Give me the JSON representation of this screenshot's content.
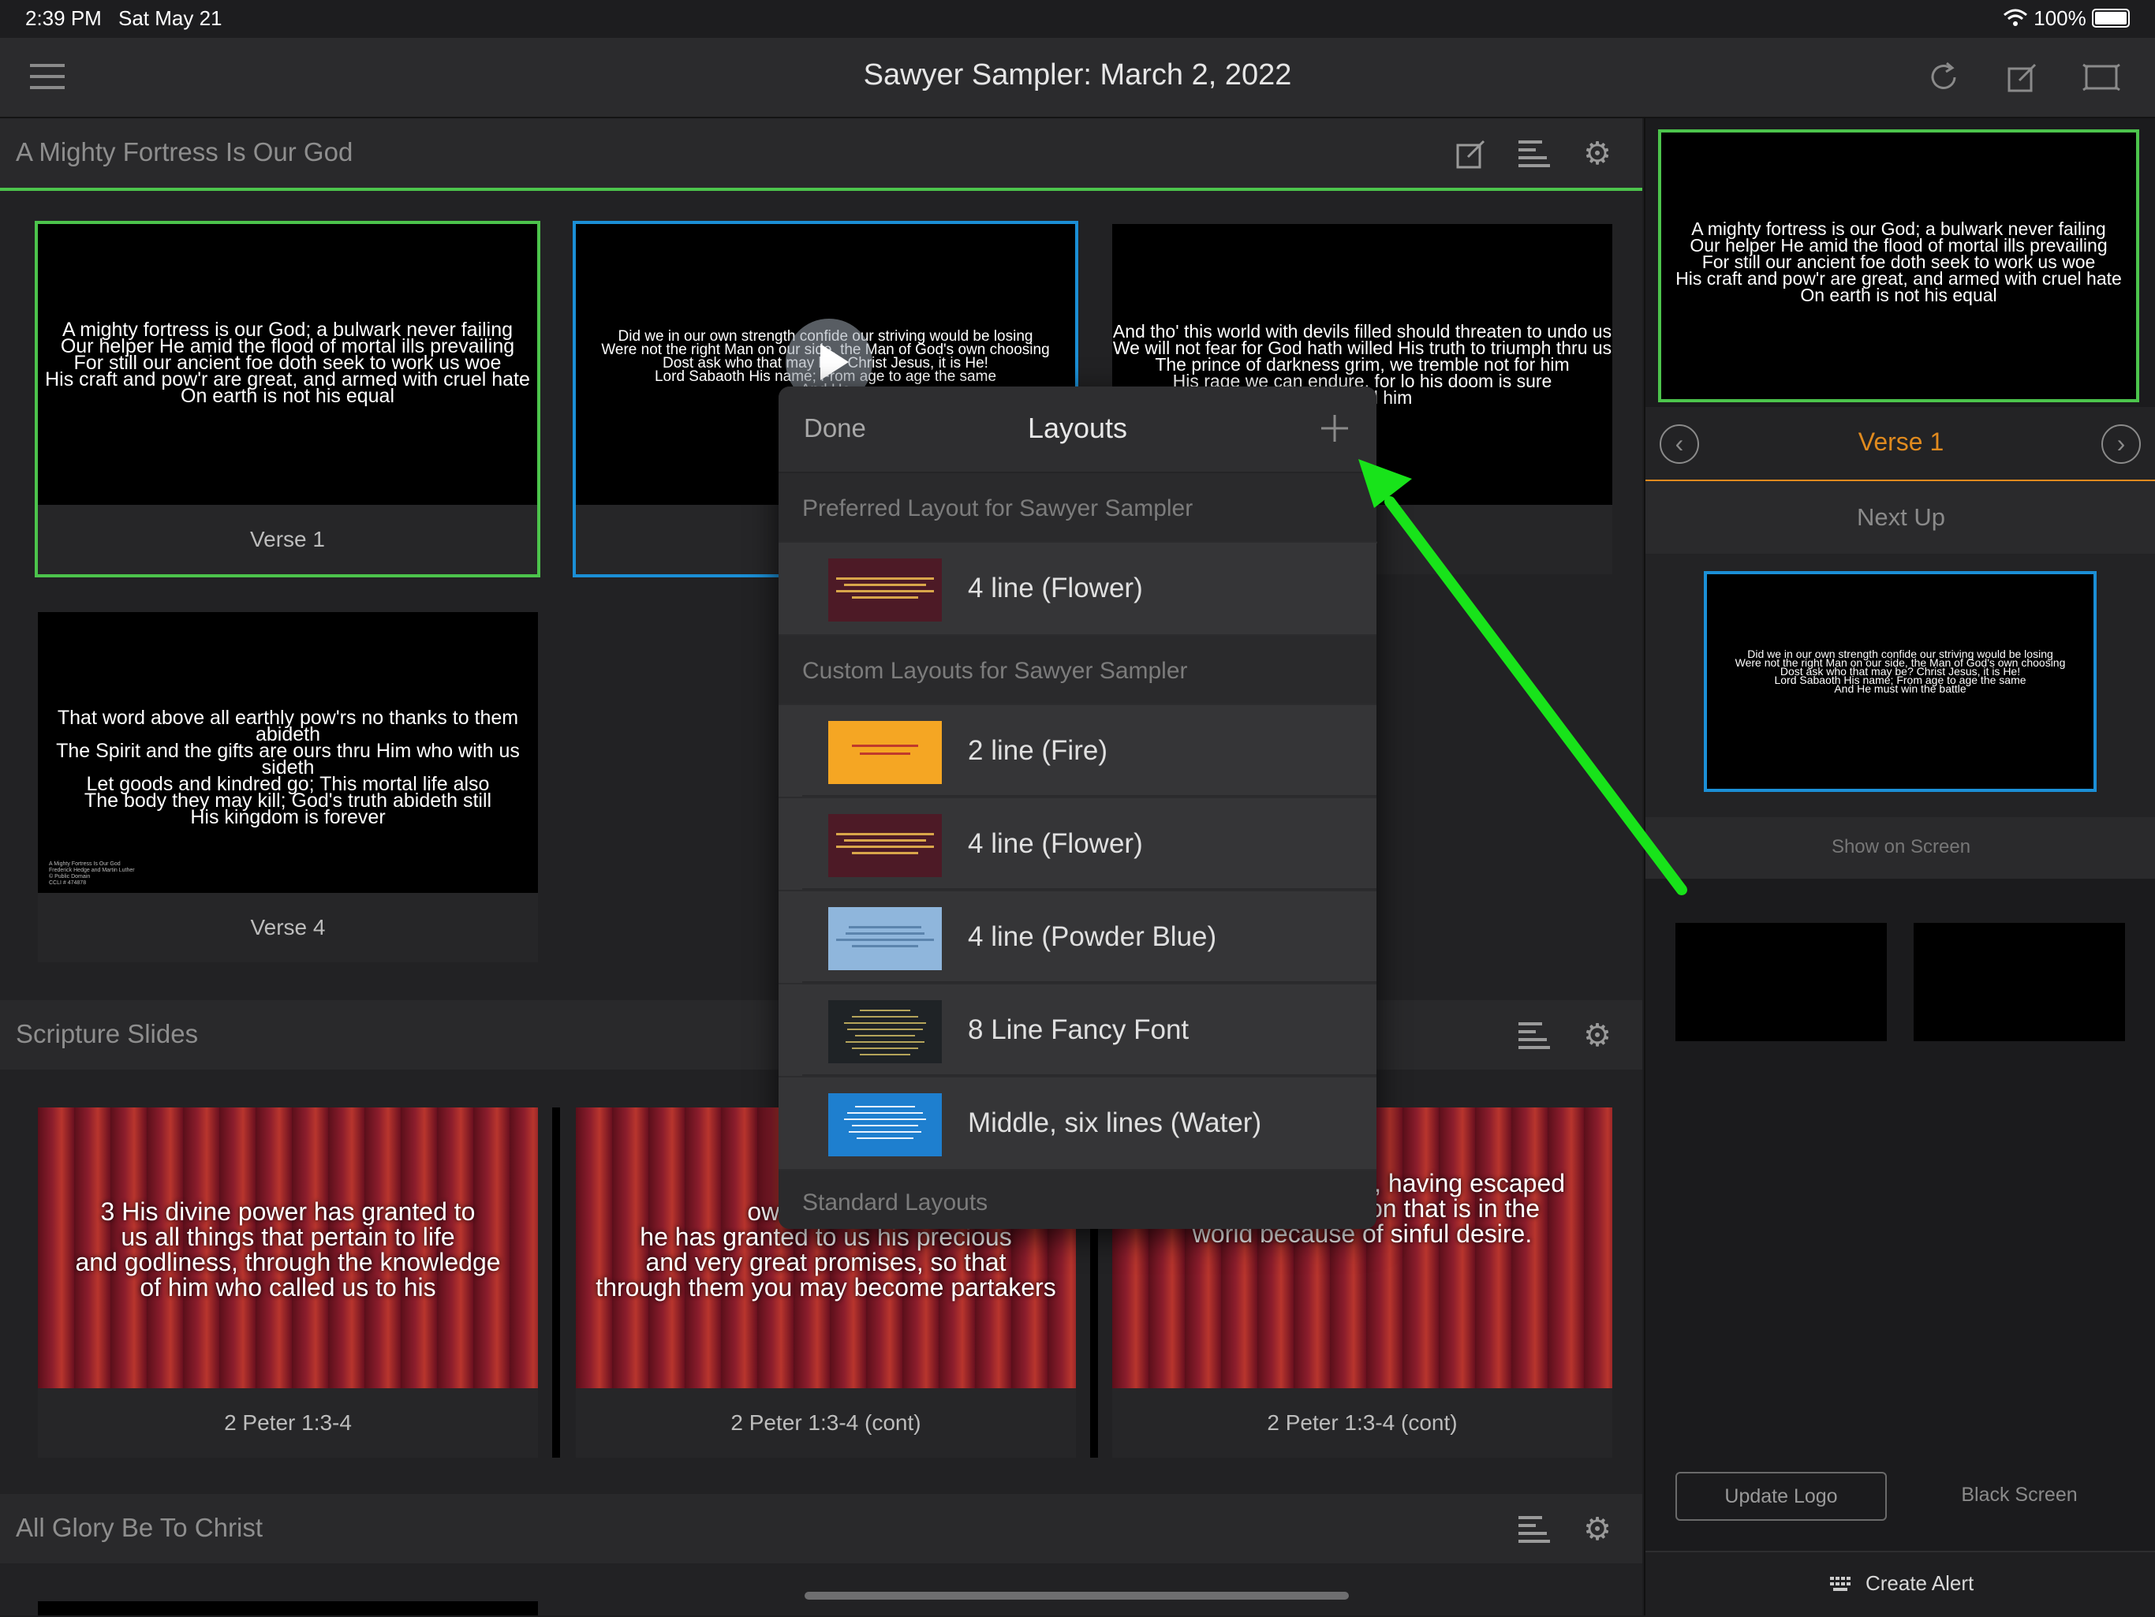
{
  "status": {
    "time": "2:39 PM",
    "date": "Sat May 21",
    "battery": "100%"
  },
  "nav": {
    "title": "Sawyer Sampler: March 2, 2022"
  },
  "sections": {
    "fortress": {
      "title": "A Mighty Fortress Is Our God",
      "slides": [
        {
          "label": "Verse 1",
          "text": "A mighty fortress is our God; a bulwark never failing\nOur helper He amid the flood of mortal ills prevailing\nFor still our ancient foe doth seek to work us woe\nHis craft and pow'r are great, and armed with cruel hate\nOn earth is not his equal"
        },
        {
          "label": "",
          "text": "Did we in our own strength confide our striving would be losing\nWere not the right Man on our side, the Man of God's own choosing\nDost ask who that may be? Christ Jesus, it is He!\nLord Sabaoth His name; From age to age the same\nAnd He"
        },
        {
          "label": "e 3",
          "text": "And tho' this world with devils filled should threaten to undo us\nWe will not fear for God hath willed His truth to triumph thru us\nThe prince of darkness grim, we tremble not for him\nHis rage we can endure, for lo his doom is sure\nshall fell him"
        },
        {
          "label": "Verse 4",
          "text": "That word above all earthly pow'rs no thanks to them abideth\nThe Spirit and the gifts are ours thru Him who with us sideth\nLet goods and kindred go; This mortal life also\nThe body they may kill; God's truth abideth still\nHis kingdom is forever",
          "footer": "A Mighty Fortress Is Our God\nFrederick Hedge and Martin Luther\n© Public Domain\nCCLI # 474878"
        }
      ]
    },
    "scripture": {
      "title": "Scripture Slides",
      "slides": [
        {
          "label": "2 Peter 1:3-4",
          "text": "3 His divine power has granted to\nus all things that pertain to life\nand godliness, through the knowledge\nof him who called us to his"
        },
        {
          "label": "2 Peter 1:3-4 (cont)",
          "text": "own glory and\nhe has granted to us his precious\nand very great promises, so that\nthrough them you may become partakers"
        },
        {
          "label": "2 Peter 1:3-4 (cont)",
          "text": "of the divine nature, having escaped\nfrom the corruption that is in the\nworld because of sinful desire."
        }
      ]
    },
    "glory": {
      "title": "All Glory Be To Christ"
    }
  },
  "right_panel": {
    "current_text": "A mighty fortress is our God; a bulwark never failing\nOur helper He amid the flood of mortal ills prevailing\nFor still our ancient foe doth seek to work us woe\nHis craft and pow'r are great, and armed with cruel hate\nOn earth is not his equal",
    "current_label": "Verse 1",
    "next_up_label": "Next Up",
    "next_text": "Did we in our own strength confide our striving would be losing\nWere not the right Man on our side, the Man of God's own choosing\nDost ask who that may be? Christ Jesus, it is He!\nLord Sabaoth His name; From age to age the same\nAnd He must win the battle",
    "show_on_screen": "Show on Screen",
    "update_logo": "Update Logo",
    "black_screen": "Black Screen",
    "create_alert": "Create Alert"
  },
  "popover": {
    "done": "Done",
    "title": "Layouts",
    "preferred_header": "Preferred Layout for Sawyer Sampler",
    "preferred": [
      {
        "name": "4 line (Flower)",
        "bg": "#4d1a26",
        "fg": "#d9a64a"
      }
    ],
    "custom_header": "Custom Layouts for Sawyer Sampler",
    "custom": [
      {
        "name": "2 line (Fire)",
        "bg": "#f5a623",
        "fg": "#c0392b"
      },
      {
        "name": "4 line (Flower)",
        "bg": "#4d1a26",
        "fg": "#d9a64a"
      },
      {
        "name": "4 line (Powder Blue)",
        "bg": "#8fb6dc",
        "fg": "#5b84ad"
      },
      {
        "name": "8 Line Fancy Font",
        "bg": "#1f2326",
        "fg": "#b5a45a"
      },
      {
        "name": "Middle, six lines (Water)",
        "bg": "#1e7fcf",
        "fg": "#e8f3ff"
      }
    ],
    "standard_header": "Standard Layouts"
  },
  "colors": {
    "accent_green": "#4cc44c",
    "accent_blue": "#1b8fd6",
    "accent_orange": "#e08a1e",
    "arrow": "#18e31a"
  }
}
